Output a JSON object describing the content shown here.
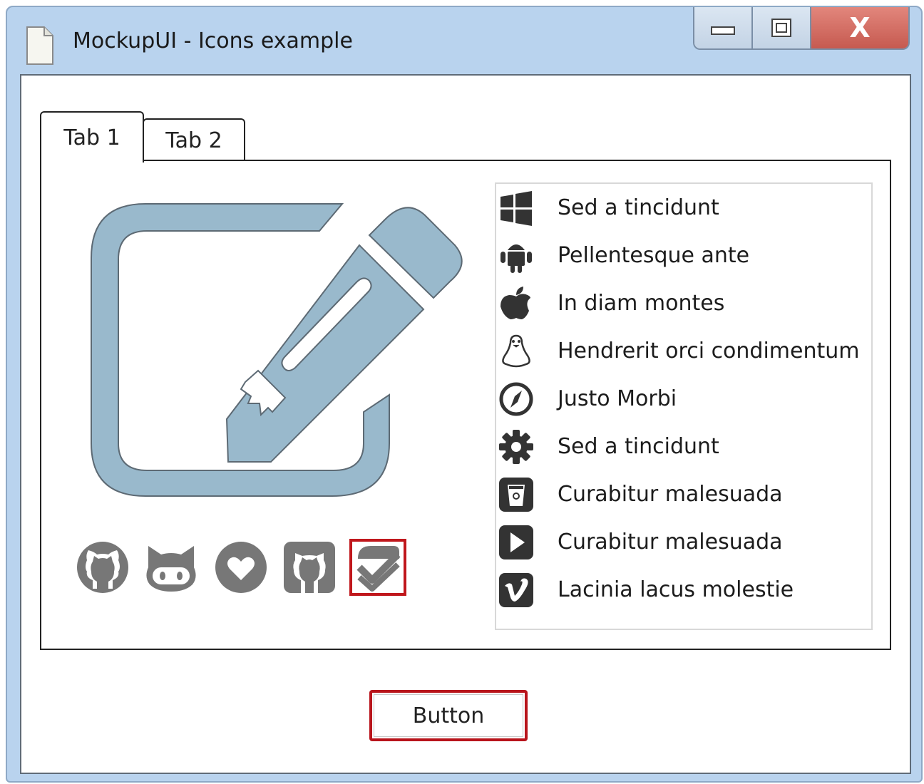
{
  "window": {
    "title": "MockupUI - Icons example",
    "minimize_icon": "minimize-icon",
    "maximize_icon": "maximize-icon",
    "close_label": "X"
  },
  "tabs": [
    {
      "label": "Tab 1",
      "active": true
    },
    {
      "label": "Tab 2",
      "active": false
    }
  ],
  "panel": {
    "large_icon": "edit-icon",
    "icon_color": "#99b9cc",
    "social_icons": [
      {
        "name": "github-circle-icon"
      },
      {
        "name": "github-octocat-icon"
      },
      {
        "name": "heart-circle-icon"
      },
      {
        "name": "github-square-icon"
      },
      {
        "name": "checkmark-badge-icon",
        "selected": true
      }
    ]
  },
  "list": {
    "items": [
      {
        "icon": "windows-icon",
        "label": "Sed a tincidunt"
      },
      {
        "icon": "android-icon",
        "label": "Pellentesque ante"
      },
      {
        "icon": "apple-icon",
        "label": "In diam montes"
      },
      {
        "icon": "linux-icon",
        "label": "Hendrerit orci condimentum"
      },
      {
        "icon": "compass-icon",
        "label": "Justo Morbi"
      },
      {
        "icon": "gear-icon",
        "label": "Sed a tincidunt"
      },
      {
        "icon": "recycle-bin-icon",
        "label": "Curabitur malesuada"
      },
      {
        "icon": "play-icon",
        "label": "Curabitur malesuada"
      },
      {
        "icon": "vimeo-icon",
        "label": "Lacinia lacus molestie"
      }
    ]
  },
  "button": {
    "label": "Button"
  },
  "colors": {
    "titlebar": "#b9d3ee",
    "close_button": "#c65a50",
    "selection_border": "#c0171c",
    "icon_gray": "#777777"
  }
}
